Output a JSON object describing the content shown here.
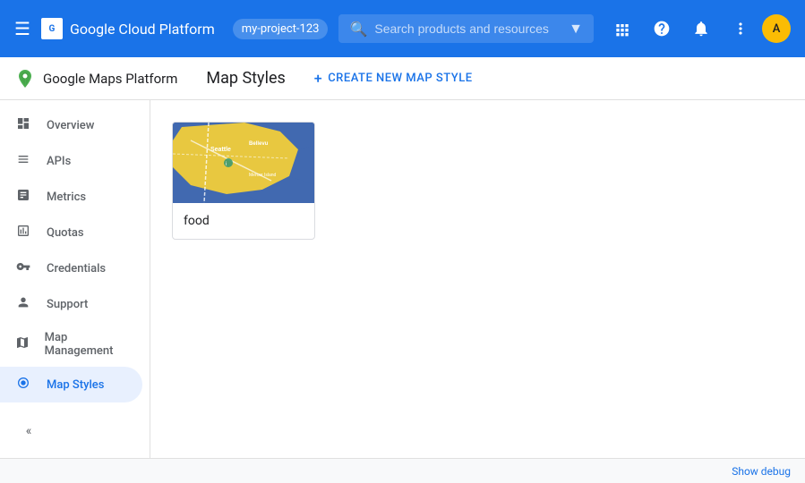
{
  "topnav": {
    "brand_name": "Google Cloud Platform",
    "account_label": "my-project-123",
    "search_placeholder": "Search products and resources",
    "hamburger_icon": "☰",
    "search_icon": "🔍",
    "expand_icon": "▼",
    "grid_icon": "⊞",
    "help_icon": "?",
    "bell_icon": "🔔",
    "more_icon": "⋮",
    "avatar_text": "A"
  },
  "secondbar": {
    "app_name": "Google Maps Platform",
    "page_title": "Map Styles",
    "create_btn_label": "CREATE NEW MAP STYLE",
    "create_icon": "+"
  },
  "sidebar": {
    "items": [
      {
        "id": "overview",
        "label": "Overview",
        "icon": "☰"
      },
      {
        "id": "apis",
        "label": "APIs",
        "icon": "≡"
      },
      {
        "id": "metrics",
        "label": "Metrics",
        "icon": "📊"
      },
      {
        "id": "quotas",
        "label": "Quotas",
        "icon": "📋"
      },
      {
        "id": "credentials",
        "label": "Credentials",
        "icon": "🔑"
      },
      {
        "id": "support",
        "label": "Support",
        "icon": "👤"
      },
      {
        "id": "map-management",
        "label": "Map Management",
        "icon": "🗺"
      },
      {
        "id": "map-styles",
        "label": "Map Styles",
        "icon": "🎨",
        "active": true
      }
    ],
    "collapse_icon": "«"
  },
  "main": {
    "map_card": {
      "label": "food"
    }
  },
  "debugbar": {
    "link_text": "Show debug"
  }
}
